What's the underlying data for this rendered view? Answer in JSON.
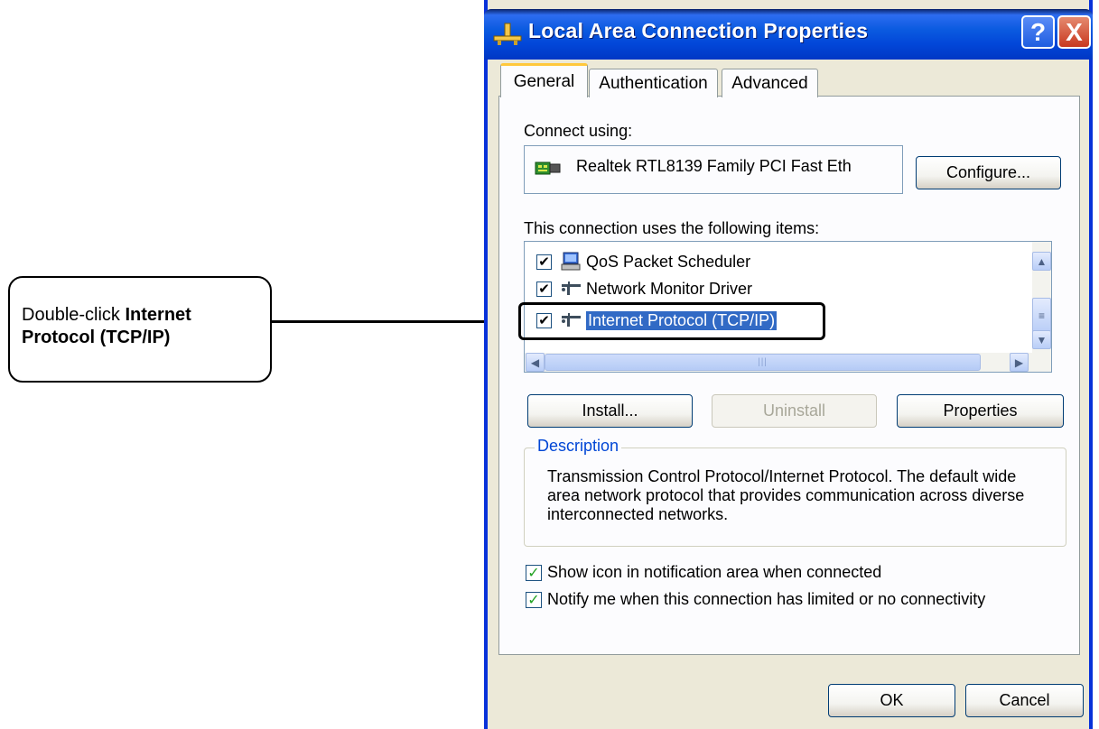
{
  "callout": {
    "prefix": "Double-click ",
    "bold": "Internet",
    "bold2": "Protocol (TCP/IP)"
  },
  "dialog": {
    "title": "Local Area Connection Properties",
    "help_label": "?",
    "close_label": "X",
    "tabs": [
      {
        "label": "General"
      },
      {
        "label": "Authentication"
      },
      {
        "label": "Advanced"
      }
    ],
    "connect_using_label": "Connect using:",
    "adapter_name": "Realtek RTL8139 Family PCI Fast Eth",
    "configure_label": "Configure...",
    "items_label": "This connection uses the following items:",
    "items": [
      {
        "label": "QoS Packet Scheduler",
        "checked": true,
        "icon": "qos-computer-icon"
      },
      {
        "label": "Network Monitor Driver",
        "checked": true,
        "icon": "network-protocol-icon"
      },
      {
        "label": "Internet Protocol (TCP/IP)",
        "checked": true,
        "icon": "network-protocol-icon",
        "selected": true
      }
    ],
    "install_label": "Install...",
    "uninstall_label": "Uninstall",
    "properties_label": "Properties",
    "description_title": "Description",
    "description_text": "Transmission Control Protocol/Internet Protocol. The default wide area network protocol that provides communication across diverse interconnected networks.",
    "show_icon_label": "Show icon in notification area when connected",
    "notify_label": "Notify me when this connection has limited or no connectivity",
    "ok_label": "OK",
    "cancel_label": "Cancel"
  },
  "colors": {
    "title_bar": "#0b5be0",
    "selection": "#316ac5",
    "tab_accent": "#ffc83c"
  }
}
